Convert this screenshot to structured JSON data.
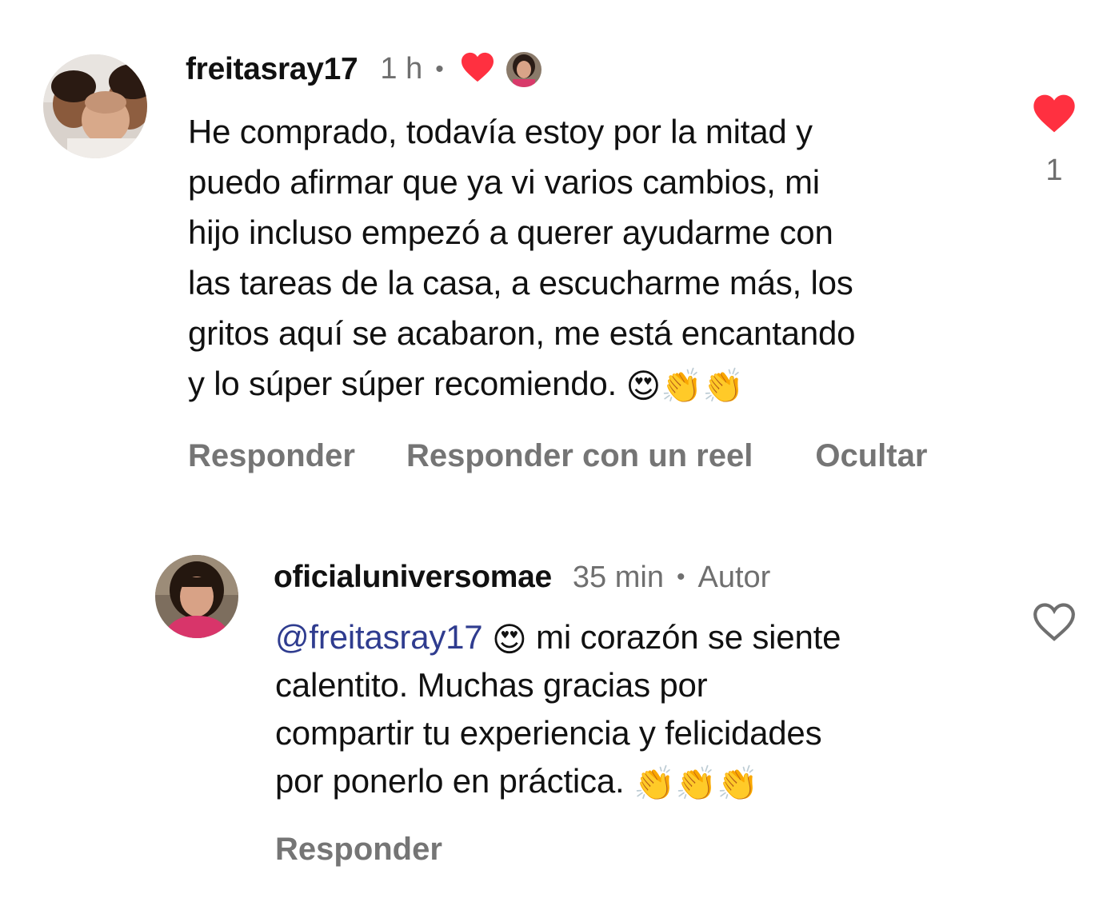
{
  "comments": [
    {
      "username": "freitasray17",
      "time": "1 h",
      "text_lines": [
        "He comprado, todavía estoy por la mitad y",
        "puedo afirmar que ya vi varios cambios, mi",
        "hijo incluso empezó a querer ayudarme con",
        "las tareas de la casa, a escucharme más, los",
        "gritos aquí se acabaron, me está encantando",
        "y lo súper súper recomiendo."
      ],
      "trailing_emojis": "😍👏👏",
      "like_count": "1",
      "liked": true,
      "actions": [
        "Responder",
        "Responder con un reel",
        "Ocultar"
      ]
    }
  ],
  "reply": {
    "username": "oficialuniversomae",
    "time": "35 min",
    "badge": "Autor",
    "mention": "@freitasray17",
    "mention_emoji": "😍",
    "text_lines": [
      "mi corazón se siente",
      "calentito. Muchas gracias por",
      "compartir tu experiencia y felicidades",
      "por ponerlo en práctica."
    ],
    "trailing_emojis": "👏👏👏",
    "liked": false,
    "actions": [
      "Responder"
    ]
  },
  "icons": {
    "liked_heart": "heart-filled-icon",
    "unliked_heart": "heart-outline-icon",
    "like_color": "#ff3040"
  }
}
